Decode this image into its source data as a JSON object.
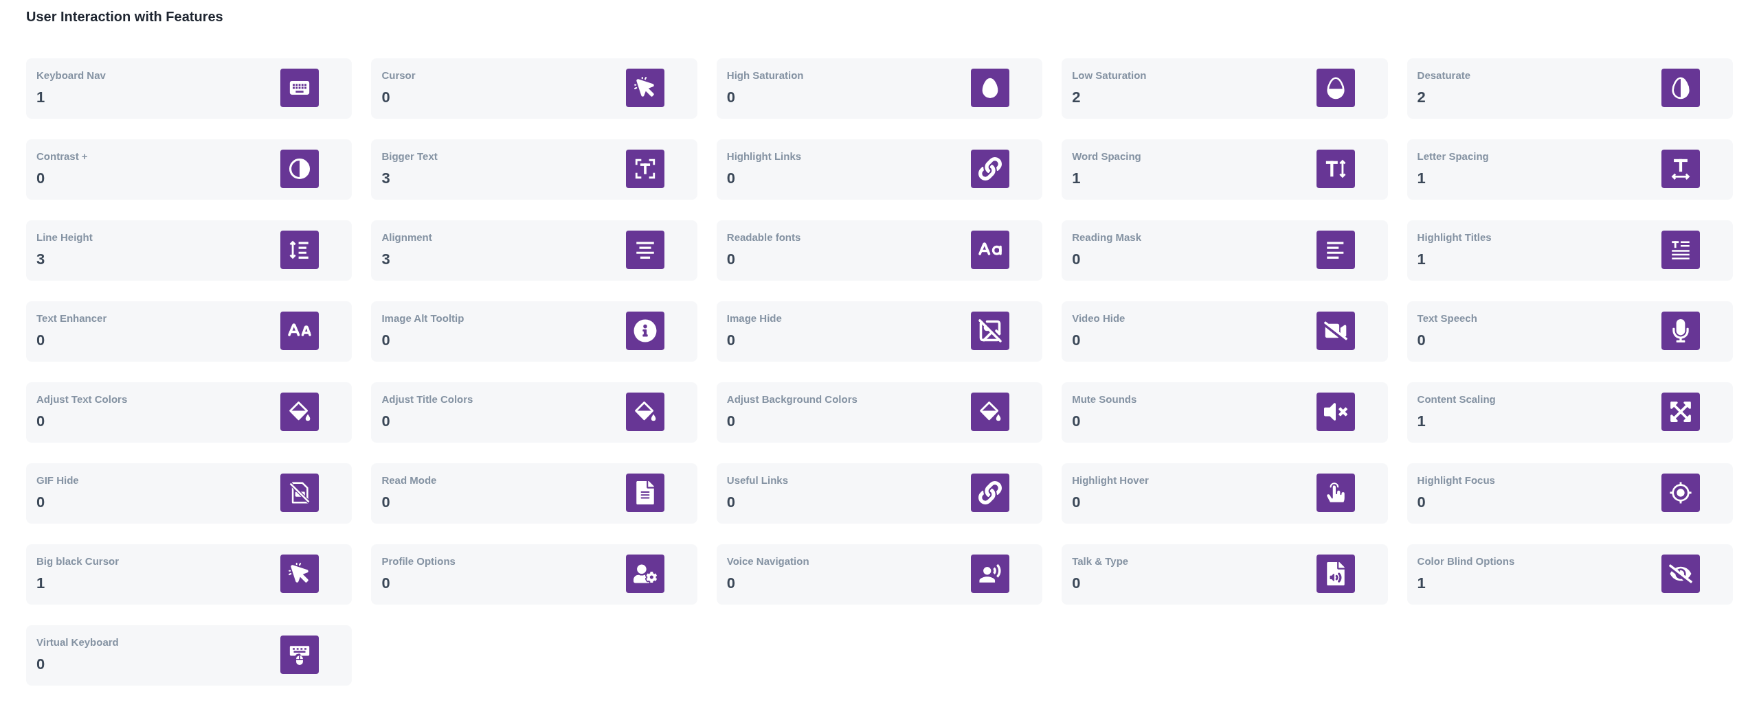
{
  "title": "User Interaction with Features",
  "features": [
    {
      "label": "Keyboard Nav",
      "count": "1"
    },
    {
      "label": "Cursor",
      "count": "0"
    },
    {
      "label": "High Saturation",
      "count": "0"
    },
    {
      "label": "Low Saturation",
      "count": "2"
    },
    {
      "label": "Desaturate",
      "count": "2"
    },
    {
      "label": "Contrast +",
      "count": "0"
    },
    {
      "label": "Bigger Text",
      "count": "3"
    },
    {
      "label": "Highlight Links",
      "count": "0"
    },
    {
      "label": "Word Spacing",
      "count": "1"
    },
    {
      "label": "Letter Spacing",
      "count": "1"
    },
    {
      "label": "Line Height",
      "count": "3"
    },
    {
      "label": "Alignment",
      "count": "3"
    },
    {
      "label": "Readable fonts",
      "count": "0"
    },
    {
      "label": "Reading Mask",
      "count": "0"
    },
    {
      "label": "Highlight Titles",
      "count": "1"
    },
    {
      "label": "Text Enhancer",
      "count": "0"
    },
    {
      "label": "Image Alt Tooltip",
      "count": "0"
    },
    {
      "label": "Image Hide",
      "count": "0"
    },
    {
      "label": "Video Hide",
      "count": "0"
    },
    {
      "label": "Text Speech",
      "count": "0"
    },
    {
      "label": "Adjust Text Colors",
      "count": "0"
    },
    {
      "label": "Adjust Title Colors",
      "count": "0"
    },
    {
      "label": "Adjust Background Colors",
      "count": "0"
    },
    {
      "label": "Mute Sounds",
      "count": "0"
    },
    {
      "label": "Content Scaling",
      "count": "1"
    },
    {
      "label": "GIF Hide",
      "count": "0"
    },
    {
      "label": "Read Mode",
      "count": "0"
    },
    {
      "label": "Useful Links",
      "count": "0"
    },
    {
      "label": "Highlight Hover",
      "count": "0"
    },
    {
      "label": "Highlight Focus",
      "count": "0"
    },
    {
      "label": "Big black Cursor",
      "count": "1"
    },
    {
      "label": "Profile Options",
      "count": "0"
    },
    {
      "label": "Voice Navigation",
      "count": "0"
    },
    {
      "label": "Talk & Type",
      "count": "0"
    },
    {
      "label": "Color Blind Options",
      "count": "1"
    },
    {
      "label": "Virtual Keyboard",
      "count": "0"
    }
  ]
}
